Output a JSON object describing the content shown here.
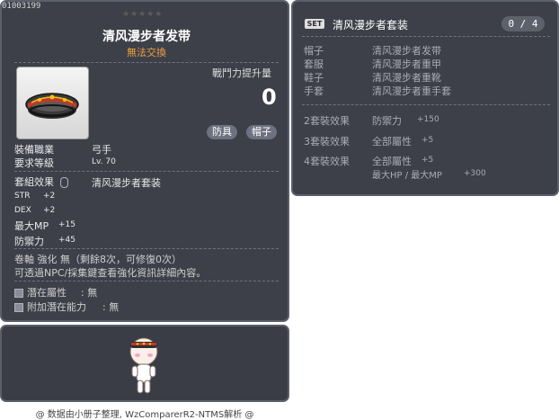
{
  "item": {
    "id": "01003199",
    "name": "清风漫步者发带",
    "trade_status": "無法交換",
    "power_label": "戰鬥力提升量",
    "power_value": "0",
    "tags": [
      "防具",
      "帽子"
    ],
    "requirements": {
      "job_label": "裝備職業",
      "job_value": "弓手",
      "level_label": "要求等級",
      "level_value": "Lv. 70"
    },
    "set_label": "套組效果",
    "set_name": "清风漫步者套装",
    "stats": [
      {
        "name": "STR",
        "value": "+2"
      },
      {
        "name": "DEX",
        "value": "+2"
      },
      {
        "name": "最大MP",
        "value": "+15"
      },
      {
        "name": "防禦力",
        "value": "+45"
      }
    ],
    "upgrade_text": "卷軸 強化 無（剩餘8次，可修復0次）",
    "npc_text": "可透過NPC/採集鍵查看強化資訊詳細內容。",
    "potential_label": "潛在屬性",
    "potential_value": ": 無",
    "bonus_potential_label": "附加潛在能力",
    "bonus_potential_value": ": 無"
  },
  "set": {
    "badge": "SET",
    "title": "清风漫步者套装",
    "count": "0 / 4",
    "pieces": [
      {
        "slot": "帽子",
        "name": "清风漫步者发带"
      },
      {
        "slot": "套服",
        "name": "清风漫步者重甲"
      },
      {
        "slot": "鞋子",
        "name": "清风漫步者重靴"
      },
      {
        "slot": "手套",
        "name": "清风漫步者重手套"
      }
    ],
    "effects": [
      {
        "label": "2套裝效果",
        "lines": [
          {
            "stat": "防禦力",
            "value": "+150"
          }
        ]
      },
      {
        "label": "3套裝效果",
        "lines": [
          {
            "stat": "全部屬性",
            "value": "+5"
          }
        ]
      },
      {
        "label": "4套裝效果",
        "lines": [
          {
            "stat": "全部屬性",
            "value": "+5"
          },
          {
            "stat": "最大HP / 最大MP",
            "value": "+300"
          }
        ]
      }
    ]
  },
  "footer": "@ 数据由小册子整理, WzComparerR2-NTMS解析 @",
  "colors": {
    "panel_bg": "#3d4049",
    "accent_orange": "#f0a040",
    "tag_bg": "#6d7180"
  }
}
